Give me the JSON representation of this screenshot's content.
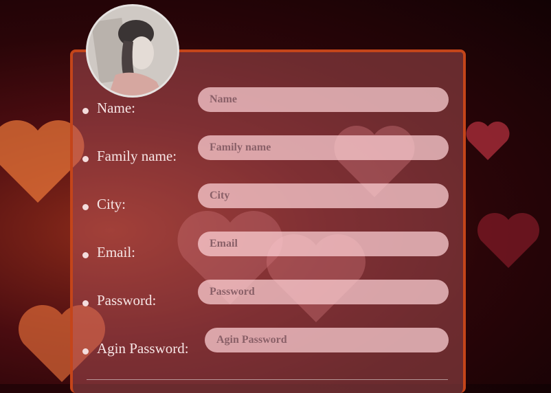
{
  "form": {
    "fields": [
      {
        "label": "Name:",
        "placeholder": "Name"
      },
      {
        "label": "Family name:",
        "placeholder": "Family name"
      },
      {
        "label": "City:",
        "placeholder": "City"
      },
      {
        "label": "Email:",
        "placeholder": "Email"
      },
      {
        "label": "Password:",
        "placeholder": "Password"
      },
      {
        "label": "Agin Password:",
        "placeholder": "Agin Password"
      }
    ]
  },
  "colors": {
    "panel_border": "#c4451a",
    "field_bg": "#ffd2d7",
    "label_text": "#f7e6e6"
  }
}
